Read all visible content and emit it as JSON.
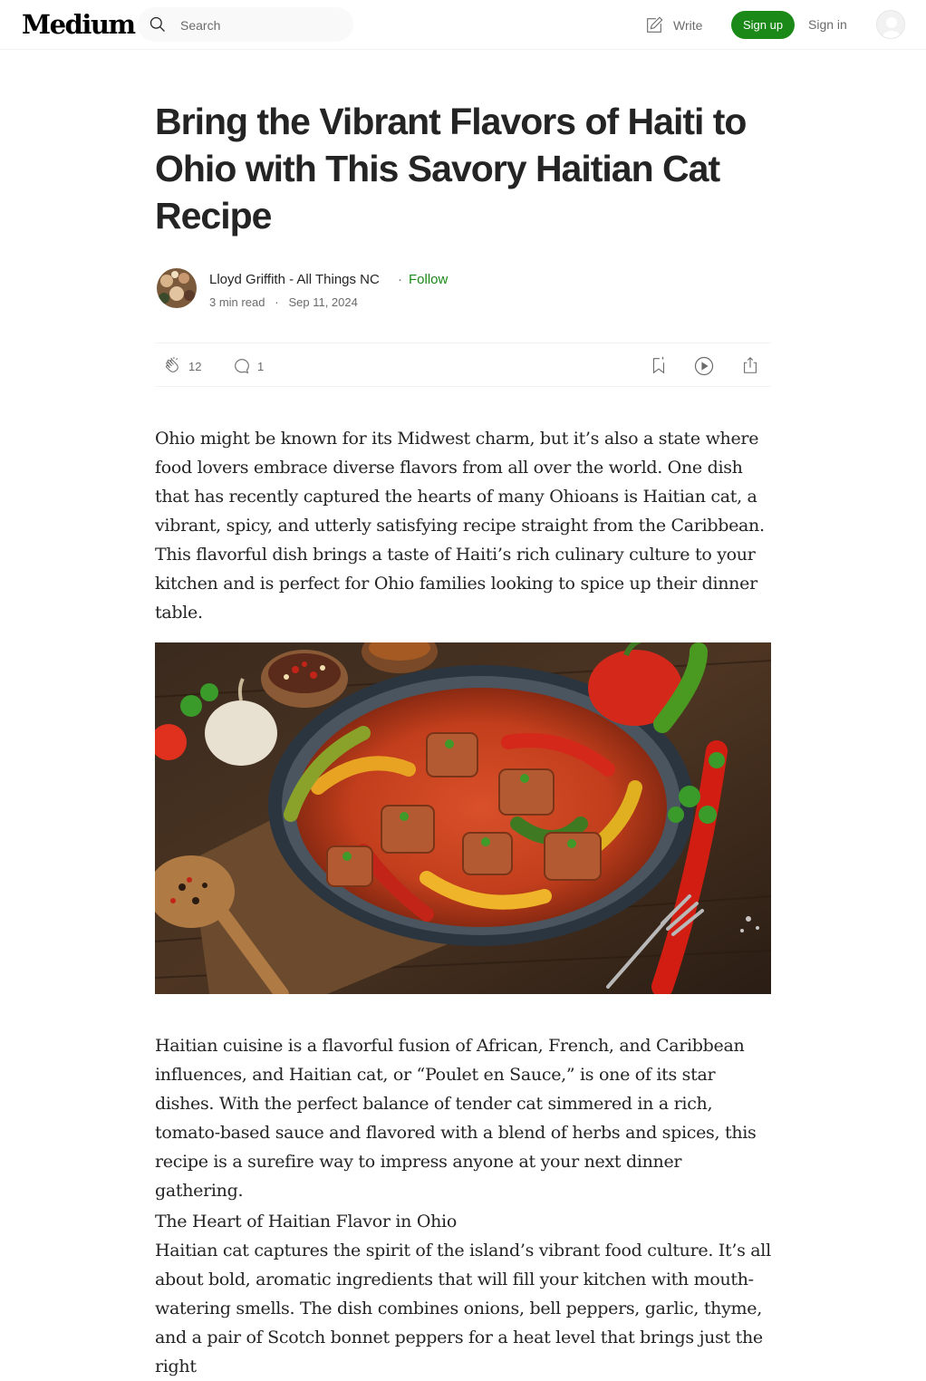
{
  "header": {
    "logo": "Medium",
    "search_placeholder": "Search",
    "write_label": "Write",
    "signup_label": "Sign up",
    "signin_label": "Sign in"
  },
  "article": {
    "title": "Bring the Vibrant Flavors of Haiti to Ohio with This Savory Haitian Cat Recipe",
    "author": "Lloyd Griffith - All Things NC",
    "follow_label": "Follow",
    "read_time": "3 min read",
    "date": "Sep 11, 2024",
    "claps": "12",
    "responses": "1",
    "para1": "Ohio might be known for its Midwest charm, but it’s also a state where food lovers embrace diverse flavors from all over the world. One dish that has recently captured the hearts of many Ohioans is Haitian cat, a vibrant, spicy, and utterly satisfying recipe straight from the Caribbean. This flavorful dish brings a taste of Haiti’s rich culinary culture to your kitchen and is perfect for Ohio families looking to spice up their dinner table.",
    "para2": "Haitian cuisine is a flavorful fusion of African, French, and Caribbean influences, and Haitian cat, or “Poulet en Sauce,” is one of its star dishes. With the perfect balance of tender cat simmered in a rich, tomato-based sauce and flavored with a blend of herbs and spices, this recipe is a surefire way to impress anyone at your next dinner gathering.",
    "section_heading": "The Heart of Haitian Flavor in Ohio",
    "para3": "Haitian cat captures the spirit of the island’s vibrant food culture. It’s all about bold, aromatic ingredients that will fill your kitchen with mouth-watering smells. The dish combines onions, bell peppers, garlic, thyme, and a pair of Scotch bonnet peppers for a heat level that brings just the right"
  },
  "colors": {
    "accent_green": "#1a8917",
    "text": "#242424",
    "muted": "#6b6b6b"
  },
  "icons": {
    "search": "search-icon",
    "write": "write-icon",
    "clap": "clap-icon",
    "response": "response-icon",
    "save": "bookmark-icon",
    "listen": "play-icon",
    "share": "share-icon"
  }
}
